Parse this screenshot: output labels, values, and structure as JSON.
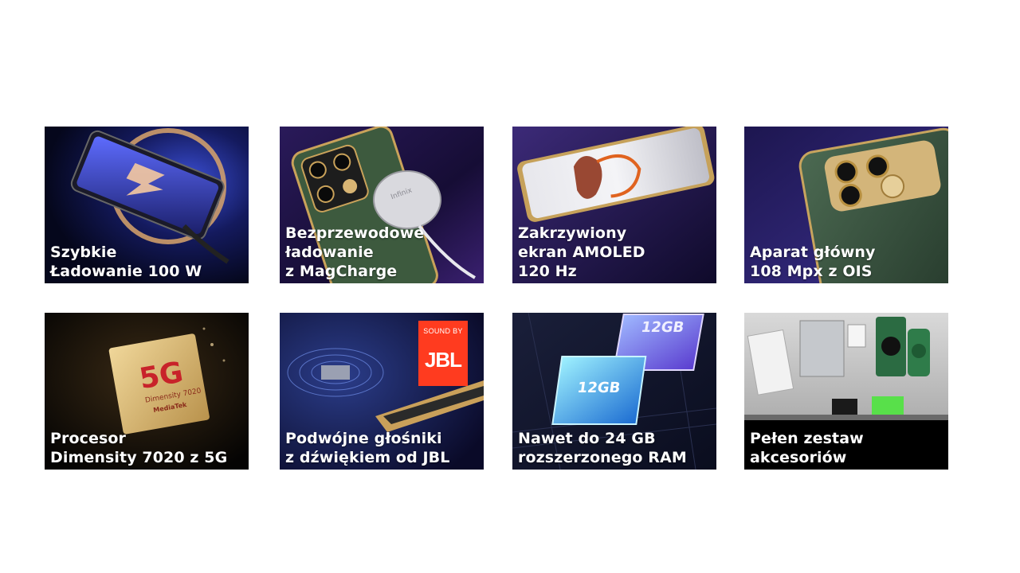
{
  "tiles": [
    {
      "id": "fast-charging",
      "caption": [
        "Szybkie",
        "Ładowanie 100 W"
      ]
    },
    {
      "id": "wireless-charging",
      "caption": [
        "Bezprzewodowe",
        "ładowanie",
        "z MagCharge"
      ],
      "brand_text": "Infinix"
    },
    {
      "id": "curved-display",
      "caption": [
        "Zakrzywiony",
        "ekran AMOLED",
        "120 Hz"
      ]
    },
    {
      "id": "main-camera",
      "caption": [
        "Aparat główny",
        "108 Mpx z OIS"
      ]
    },
    {
      "id": "processor",
      "caption": [
        "Procesor",
        "Dimensity 7020 z 5G"
      ],
      "chip_text": {
        "big": "5G",
        "model": "Dimensity 7020",
        "brand": "MediaTek"
      }
    },
    {
      "id": "speakers",
      "caption": [
        "Podwójne głośniki",
        "z dźwiękiem od JBL"
      ],
      "badge": {
        "top": "SOUND BY",
        "logo": "JBL"
      }
    },
    {
      "id": "ram",
      "caption": [
        "Nawet do 24 GB",
        "rozszerzonego RAM"
      ],
      "chip_labels": [
        "12GB",
        "12GB"
      ]
    },
    {
      "id": "accessories",
      "caption": [
        "Pełen zestaw",
        "akcesoriów"
      ]
    }
  ]
}
